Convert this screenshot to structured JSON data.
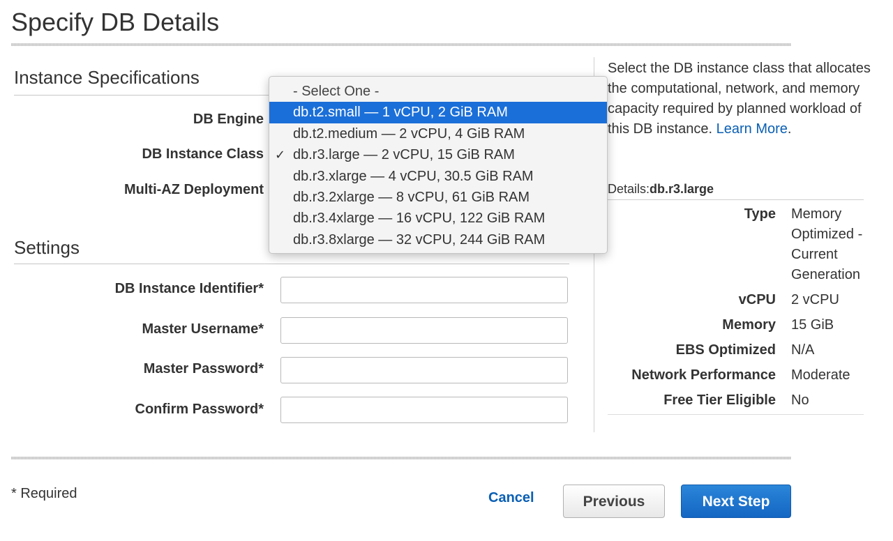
{
  "page": {
    "title": "Specify DB Details"
  },
  "instance_specs": {
    "heading": "Instance Specifications",
    "db_engine_label": "DB Engine",
    "instance_class_label": "DB Instance Class",
    "multi_az_label": "Multi-AZ Deployment"
  },
  "dropdown": {
    "selected_value": "db.r3.large — 2 vCPU, 15 GiB RAM",
    "check_glyph": "✓",
    "options": [
      {
        "label": "- Select One -",
        "state": "placeholder"
      },
      {
        "label": "db.t2.small — 1 vCPU, 2 GiB RAM",
        "state": "highlighted"
      },
      {
        "label": "db.t2.medium — 2 vCPU, 4 GiB RAM",
        "state": "normal"
      },
      {
        "label": "db.r3.large — 2 vCPU, 15 GiB RAM",
        "state": "checked"
      },
      {
        "label": "db.r3.xlarge — 4 vCPU, 30.5 GiB RAM",
        "state": "normal"
      },
      {
        "label": "db.r3.2xlarge — 8 vCPU, 61 GiB RAM",
        "state": "normal"
      },
      {
        "label": "db.r3.4xlarge — 16 vCPU, 122 GiB RAM",
        "state": "normal"
      },
      {
        "label": "db.r3.8xlarge — 32 vCPU, 244 GiB RAM",
        "state": "normal"
      }
    ]
  },
  "settings": {
    "heading": "Settings",
    "fields": {
      "identifier": {
        "label": "DB Instance Identifier*",
        "value": ""
      },
      "username": {
        "label": "Master Username*",
        "value": ""
      },
      "password": {
        "label": "Master Password*",
        "value": ""
      },
      "confirm": {
        "label": "Confirm Password*",
        "value": ""
      }
    }
  },
  "help": {
    "text": "Select the DB instance class that allocates the computational, network, and memory capacity required by planned workload of this DB instance.",
    "link_text": "Learn More",
    "trailing": "."
  },
  "details": {
    "prefix": "Details:",
    "instance": "db.r3.large",
    "rows": [
      {
        "key": "Type",
        "value": "Memory Optimized - Current Generation"
      },
      {
        "key": "vCPU",
        "value": "2 vCPU"
      },
      {
        "key": "Memory",
        "value": "15 GiB"
      },
      {
        "key": "EBS Optimized",
        "value": "N/A"
      },
      {
        "key": "Network Performance",
        "value": "Moderate"
      },
      {
        "key": "Free Tier Eligible",
        "value": "No"
      }
    ]
  },
  "footer": {
    "required_note": "* Required",
    "cancel_label": "Cancel",
    "previous_label": "Previous",
    "next_label": "Next Step"
  },
  "colors": {
    "link": "#0a5fb4",
    "highlight": "#1b6fd8",
    "primary_button": "#1466c2"
  }
}
